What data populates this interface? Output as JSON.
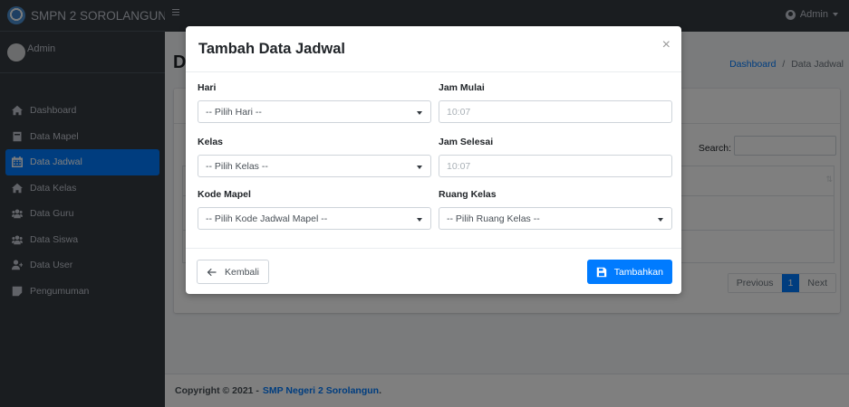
{
  "app": {
    "brand": "SMPN 2 SOROLANGUN"
  },
  "sidebar": {
    "user_name": "Admin",
    "items": [
      {
        "label": "Dashboard",
        "icon": "home-icon"
      },
      {
        "label": "Data Mapel",
        "icon": "book-icon"
      },
      {
        "label": "Data Jadwal",
        "icon": "calendar-icon",
        "active": true
      },
      {
        "label": "Data Kelas",
        "icon": "home-icon"
      },
      {
        "label": "Data Guru",
        "icon": "users-icon"
      },
      {
        "label": "Data Siswa",
        "icon": "users-icon"
      },
      {
        "label": "Data User",
        "icon": "user-plus-icon"
      },
      {
        "label": "Pengumuman",
        "icon": "note-icon"
      }
    ]
  },
  "topbar": {
    "user_label": "Admin"
  },
  "page": {
    "title_initial": "D",
    "breadcrumb": {
      "home": "Dashboard",
      "separator": "/",
      "current": "Data Jadwal"
    },
    "search_label": "Search:",
    "sort_icon": "⇅",
    "pagination": {
      "previous": "Previous",
      "current": "1",
      "next": "Next"
    }
  },
  "footer": {
    "text": "Copyright © 2021 -",
    "link": "SMP Negeri 2 Sorolangun",
    "dot": "."
  },
  "modal": {
    "title": "Tambah Data Jadwal",
    "close": "×",
    "fields": {
      "hari": {
        "label": "Hari",
        "value": "-- Pilih Hari --"
      },
      "jam_mulai": {
        "label": "Jam Mulai",
        "value": "10:07"
      },
      "kelas": {
        "label": "Kelas",
        "value": "-- Pilih Kelas --"
      },
      "jam_selesai": {
        "label": "Jam Selesai",
        "value": "10:07"
      },
      "kode_mapel": {
        "label": "Kode Mapel",
        "value": "-- Pilih Kode Jadwal Mapel --"
      },
      "ruang_kelas": {
        "label": "Ruang Kelas",
        "value": "-- Pilih Ruang Kelas --"
      }
    },
    "back_label": "Kembali",
    "submit_label": "Tambahkan"
  },
  "colors": {
    "primary": "#007bff",
    "sidebar": "#343a40",
    "overlay": "rgba(0,0,0,0.5)"
  }
}
